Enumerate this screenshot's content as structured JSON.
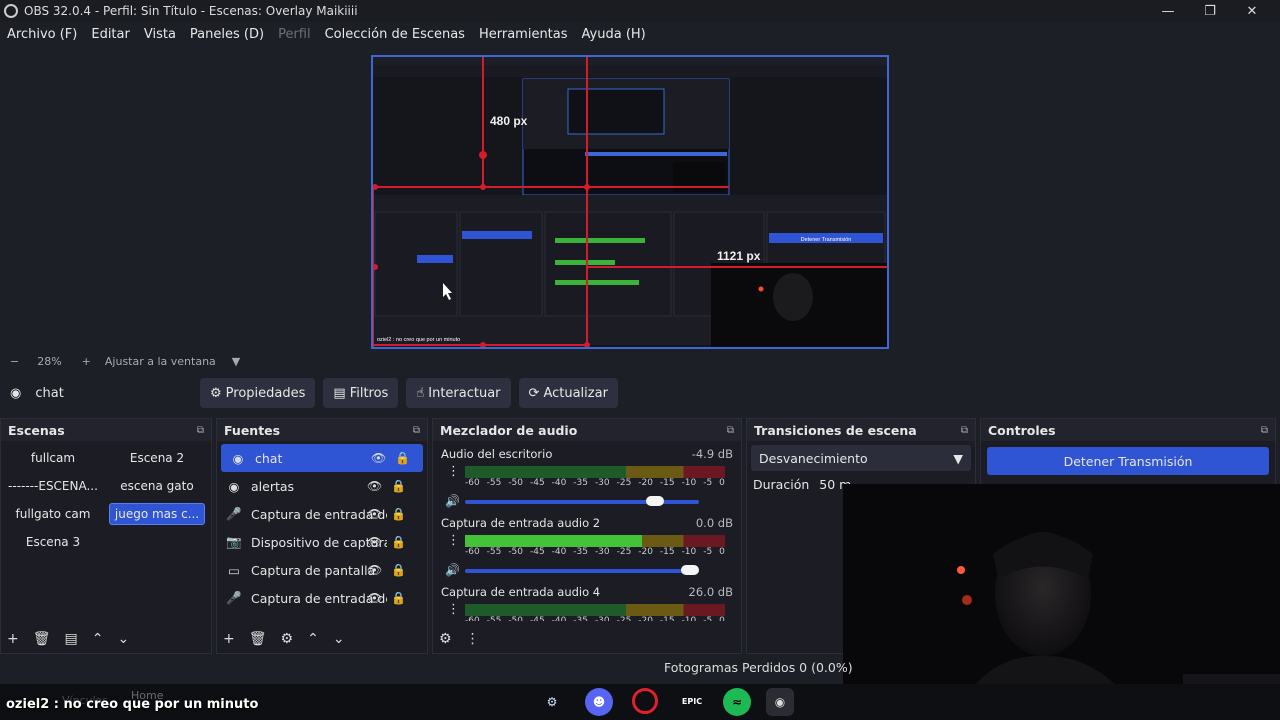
{
  "window": {
    "title": "OBS 32.0.4 - Perfil: Sin Título - Escenas: Overlay Maikiiii"
  },
  "menu": [
    {
      "label": "Archivo (F)",
      "disabled": false
    },
    {
      "label": "Editar",
      "disabled": false
    },
    {
      "label": "Vista",
      "disabled": false
    },
    {
      "label": "Paneles (D)",
      "disabled": false
    },
    {
      "label": "Perfil",
      "disabled": true
    },
    {
      "label": "Colección de Escenas",
      "disabled": false
    },
    {
      "label": "Herramientas",
      "disabled": false
    },
    {
      "label": "Ayuda (H)",
      "disabled": false
    }
  ],
  "preview": {
    "overlay_label_480": "480 px",
    "overlay_label_1121": "1121 px",
    "nested_stop_label": "Detener Transmisión",
    "nested_chat": "oziel2 : no creo que por un minuto"
  },
  "zoom": {
    "minus": "−",
    "percent": "28%",
    "plus": "+",
    "fit_label": "Ajustar a la ventana"
  },
  "source_toolbar": {
    "selected_source": "chat",
    "buttons": [
      "Propiedades",
      "Filtros",
      "Interactuar",
      "Actualizar"
    ]
  },
  "scenes": {
    "title": "Escenas",
    "items": [
      "fullcam",
      "Escena 2",
      "-------ESCENA...",
      "escena gato",
      "fullgato cam",
      "juego mas c...",
      "Escena 3"
    ],
    "active_index": 5
  },
  "sources": {
    "title": "Fuentes",
    "items": [
      {
        "name": "chat",
        "icon": "browser-icon",
        "active": true
      },
      {
        "name": "alertas",
        "icon": "browser-icon",
        "active": false
      },
      {
        "name": "Captura de entrada de audio",
        "icon": "mic-icon",
        "active": false
      },
      {
        "name": "Dispositivo de captura",
        "icon": "camera-icon",
        "active": false
      },
      {
        "name": "Captura de pantalla",
        "icon": "monitor-icon",
        "active": false
      },
      {
        "name": "Captura de entrada de audio",
        "icon": "mic-icon",
        "active": false
      }
    ]
  },
  "mixer": {
    "title": "Mezclador de audio",
    "scale": [
      "-60",
      "-55",
      "-50",
      "-45",
      "-40",
      "-35",
      "-30",
      "-25",
      "-20",
      "-15",
      "-10",
      "-5",
      "0"
    ],
    "channels": [
      {
        "name": "Audio del escritorio",
        "db": "-4.9 dB",
        "level": 0.0,
        "volume": 0.85
      },
      {
        "name": "Captura de entrada audio 2",
        "db": "0.0 dB",
        "level": 0.68,
        "volume": 1.0
      },
      {
        "name": "Captura de entrada audio 4",
        "db": "26.0 dB",
        "level": 0.0,
        "volume": 1.0
      }
    ]
  },
  "transitions": {
    "title": "Transiciones de escena",
    "selected": "Desvanecimiento",
    "duration_label": "Duración",
    "duration_value": "50 m"
  },
  "controls": {
    "title": "Controles",
    "stop_stream": "Detener Transmisión"
  },
  "status": {
    "dropped_frames": "Fotogramas Perdidos 0 (0.0%)"
  },
  "chat_overlay": {
    "user": "oziel2",
    "message": " : no creo que por un minuto"
  },
  "taskbar": {
    "faded_text_1": "Vínculos",
    "faded_text_2": "Home"
  },
  "colors": {
    "accent": "#2f55d4",
    "background": "#1d1f27",
    "dock": "#1b1c24"
  }
}
